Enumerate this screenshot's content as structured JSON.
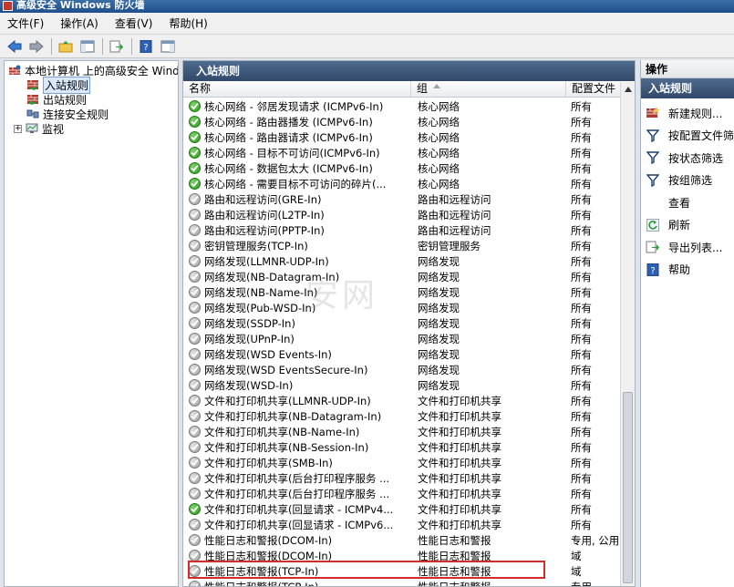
{
  "window": {
    "title": "高级安全 Windows 防火墙"
  },
  "menu": [
    "文件(F)",
    "操作(A)",
    "查看(V)",
    "帮助(H)"
  ],
  "toolbar_icons": [
    "back-arrow-icon",
    "forward-arrow-icon",
    "up-folder-icon",
    "console-tree-icon",
    "export-icon",
    "help-icon",
    "show-action-pane-icon"
  ],
  "tree": {
    "root": "本地计算机 上的高级安全 Windows",
    "items": [
      {
        "label": "入站规则",
        "selected": true
      },
      {
        "label": "出站规则",
        "selected": false
      },
      {
        "label": "连接安全规则",
        "selected": false
      },
      {
        "label": "监视",
        "selected": false
      }
    ]
  },
  "main": {
    "title": "入站规则",
    "columns": {
      "name": "名称",
      "group": "组",
      "profile": "配置文件"
    },
    "rows": [
      {
        "enabled": true,
        "name": "核心网络 - 邻居发现请求 (ICMPv6-In)",
        "group": "核心网络",
        "profile": "所有"
      },
      {
        "enabled": true,
        "name": "核心网络 - 路由器播发 (ICMPv6-In)",
        "group": "核心网络",
        "profile": "所有"
      },
      {
        "enabled": true,
        "name": "核心网络 - 路由器请求 (ICMPv6-In)",
        "group": "核心网络",
        "profile": "所有"
      },
      {
        "enabled": true,
        "name": "核心网络 - 目标不可访问(ICMPv6-In)",
        "group": "核心网络",
        "profile": "所有"
      },
      {
        "enabled": true,
        "name": "核心网络 - 数据包太大 (ICMPv6-In)",
        "group": "核心网络",
        "profile": "所有"
      },
      {
        "enabled": true,
        "name": "核心网络 - 需要目标不可访问的碎片(...",
        "group": "核心网络",
        "profile": "所有"
      },
      {
        "enabled": false,
        "name": "路由和远程访问(GRE-In)",
        "group": "路由和远程访问",
        "profile": "所有"
      },
      {
        "enabled": false,
        "name": "路由和远程访问(L2TP-In)",
        "group": "路由和远程访问",
        "profile": "所有"
      },
      {
        "enabled": false,
        "name": "路由和远程访问(PPTP-In)",
        "group": "路由和远程访问",
        "profile": "所有"
      },
      {
        "enabled": false,
        "name": "密钥管理服务(TCP-In)",
        "group": "密钥管理服务",
        "profile": "所有"
      },
      {
        "enabled": false,
        "name": "网络发现(LLMNR-UDP-In)",
        "group": "网络发现",
        "profile": "所有"
      },
      {
        "enabled": false,
        "name": "网络发现(NB-Datagram-In)",
        "group": "网络发现",
        "profile": "所有"
      },
      {
        "enabled": false,
        "name": "网络发现(NB-Name-In)",
        "group": "网络发现",
        "profile": "所有"
      },
      {
        "enabled": false,
        "name": "网络发现(Pub-WSD-In)",
        "group": "网络发现",
        "profile": "所有"
      },
      {
        "enabled": false,
        "name": "网络发现(SSDP-In)",
        "group": "网络发现",
        "profile": "所有"
      },
      {
        "enabled": false,
        "name": "网络发现(UPnP-In)",
        "group": "网络发现",
        "profile": "所有"
      },
      {
        "enabled": false,
        "name": "网络发现(WSD Events-In)",
        "group": "网络发现",
        "profile": "所有"
      },
      {
        "enabled": false,
        "name": "网络发现(WSD EventsSecure-In)",
        "group": "网络发现",
        "profile": "所有"
      },
      {
        "enabled": false,
        "name": "网络发现(WSD-In)",
        "group": "网络发现",
        "profile": "所有"
      },
      {
        "enabled": false,
        "name": "文件和打印机共享(LLMNR-UDP-In)",
        "group": "文件和打印机共享",
        "profile": "所有"
      },
      {
        "enabled": false,
        "name": "文件和打印机共享(NB-Datagram-In)",
        "group": "文件和打印机共享",
        "profile": "所有"
      },
      {
        "enabled": false,
        "name": "文件和打印机共享(NB-Name-In)",
        "group": "文件和打印机共享",
        "profile": "所有"
      },
      {
        "enabled": false,
        "name": "文件和打印机共享(NB-Session-In)",
        "group": "文件和打印机共享",
        "profile": "所有"
      },
      {
        "enabled": false,
        "name": "文件和打印机共享(SMB-In)",
        "group": "文件和打印机共享",
        "profile": "所有"
      },
      {
        "enabled": false,
        "name": "文件和打印机共享(后台打印程序服务 ...",
        "group": "文件和打印机共享",
        "profile": "所有"
      },
      {
        "enabled": false,
        "name": "文件和打印机共享(后台打印程序服务 ...",
        "group": "文件和打印机共享",
        "profile": "所有"
      },
      {
        "enabled": true,
        "name": "文件和打印机共享(回显请求 - ICMPv4...",
        "group": "文件和打印机共享",
        "profile": "所有"
      },
      {
        "enabled": false,
        "name": "文件和打印机共享(回显请求 - ICMPv6...",
        "group": "文件和打印机共享",
        "profile": "所有"
      },
      {
        "enabled": false,
        "name": "性能日志和警报(DCOM-In)",
        "group": "性能日志和警报",
        "profile": "专用, 公用"
      },
      {
        "enabled": false,
        "name": "性能日志和警报(DCOM-In)",
        "group": "性能日志和警报",
        "profile": "域"
      },
      {
        "enabled": false,
        "name": "性能日志和警报(TCP-In)",
        "group": "性能日志和警报",
        "profile": "域"
      },
      {
        "enabled": false,
        "name": "性能日志和警报(TCP-In)",
        "group": "性能日志和警报",
        "profile": "专用"
      }
    ]
  },
  "actions": {
    "title": "操作",
    "section": "入站规则",
    "items": [
      {
        "label": "新建规则...",
        "icon": "new-rule-icon"
      },
      {
        "label": "按配置文件筛",
        "icon": "filter-icon"
      },
      {
        "label": "按状态筛选",
        "icon": "filter-icon"
      },
      {
        "label": "按组筛选",
        "icon": "filter-icon"
      },
      {
        "label": "查看",
        "icon": ""
      },
      {
        "label": "刷新",
        "icon": "refresh-icon"
      },
      {
        "label": "导出列表...",
        "icon": "export-list-icon"
      },
      {
        "label": "帮助",
        "icon": "help-icon"
      }
    ]
  },
  "watermark": "安网",
  "colors": {
    "header": "#3f5a7c",
    "enabled": "#2a9a1c",
    "disabled": "#9c9c9c",
    "highlight": "#d62b2b"
  }
}
